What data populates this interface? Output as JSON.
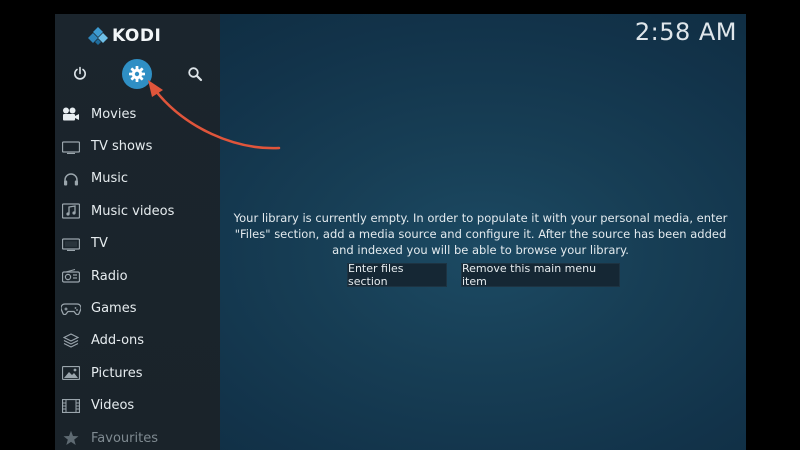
{
  "app": {
    "logo_text": "KODI",
    "clock": "2:58 AM"
  },
  "top_controls": {
    "power": {
      "icon": "power-icon"
    },
    "settings": {
      "icon": "gear-icon",
      "accent": "#2f8fc4"
    },
    "search": {
      "icon": "search-icon"
    }
  },
  "menu": {
    "items": [
      {
        "label": "Movies",
        "icon": "movies-icon"
      },
      {
        "label": "TV shows",
        "icon": "tv-shows-icon"
      },
      {
        "label": "Music",
        "icon": "headphones-icon"
      },
      {
        "label": "Music videos",
        "icon": "music-video-icon"
      },
      {
        "label": "TV",
        "icon": "tv-icon"
      },
      {
        "label": "Radio",
        "icon": "radio-icon"
      },
      {
        "label": "Games",
        "icon": "gamepad-icon"
      },
      {
        "label": "Add-ons",
        "icon": "addons-icon"
      },
      {
        "label": "Pictures",
        "icon": "pictures-icon"
      },
      {
        "label": "Videos",
        "icon": "videos-icon"
      },
      {
        "label": "Favourites",
        "icon": "star-icon"
      }
    ]
  },
  "main": {
    "message": "Your library is currently empty. In order to populate it with your personal media, enter \"Files\" section, add a media source and configure it. After the source has been added and indexed you will be able to browse your library.",
    "buttons": {
      "enter_files": "Enter files section",
      "remove_item": "Remove this main menu item"
    }
  },
  "annotation": {
    "arrow_color": "#e0553b"
  }
}
